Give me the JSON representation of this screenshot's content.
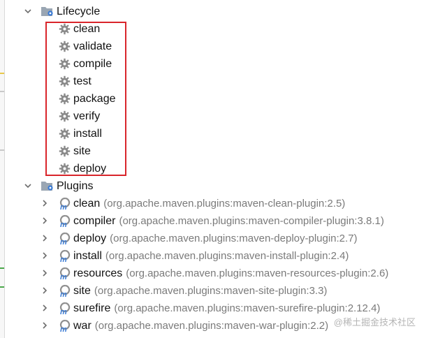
{
  "tree": {
    "lifecycle": {
      "label": "Lifecycle",
      "items": [
        "clean",
        "validate",
        "compile",
        "test",
        "package",
        "verify",
        "install",
        "site",
        "deploy"
      ]
    },
    "plugins": {
      "label": "Plugins",
      "items": [
        {
          "name": "clean",
          "desc": "(org.apache.maven.plugins:maven-clean-plugin:2.5)"
        },
        {
          "name": "compiler",
          "desc": "(org.apache.maven.plugins:maven-compiler-plugin:3.8.1)"
        },
        {
          "name": "deploy",
          "desc": "(org.apache.maven.plugins:maven-deploy-plugin:2.7)"
        },
        {
          "name": "install",
          "desc": "(org.apache.maven.plugins:maven-install-plugin:2.4)"
        },
        {
          "name": "resources",
          "desc": "(org.apache.maven.plugins:maven-resources-plugin:2.6)"
        },
        {
          "name": "site",
          "desc": "(org.apache.maven.plugins:maven-site-plugin:3.3)"
        },
        {
          "name": "surefire",
          "desc": "(org.apache.maven.plugins:maven-surefire-plugin:2.12.4)"
        },
        {
          "name": "war",
          "desc": "(org.apache.maven.plugins:maven-war-plugin:2.2)"
        }
      ]
    }
  },
  "watermark": "@稀土掘金技术社区",
  "colors": {
    "highlight_box": "#d9252b",
    "gear": "#8a8a8a",
    "folder": "#9aa6b3",
    "plugin_m": "#3a7bd5"
  },
  "icons": {
    "expanded": "chevron-down-icon",
    "collapsed": "chevron-right-icon",
    "goal": "gear-icon",
    "group": "folder-gear-icon",
    "plugin": "maven-plugin-icon"
  }
}
